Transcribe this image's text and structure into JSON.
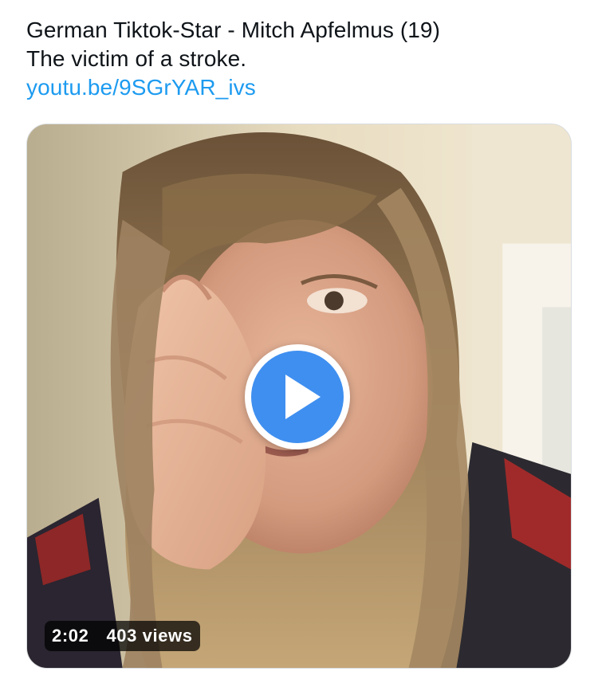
{
  "tweet": {
    "line1": "German Tiktok-Star - Mitch Apfelmus (19)",
    "line2": "The victim of a stroke.",
    "link": "youtu.be/9SGrYAR_ivs"
  },
  "video": {
    "duration": "2:02",
    "views": "403 views",
    "play_icon": "play-icon",
    "accent_color": "#3f8ff0"
  },
  "colors": {
    "link": "#1d9bf0",
    "text": "#0f1419"
  }
}
